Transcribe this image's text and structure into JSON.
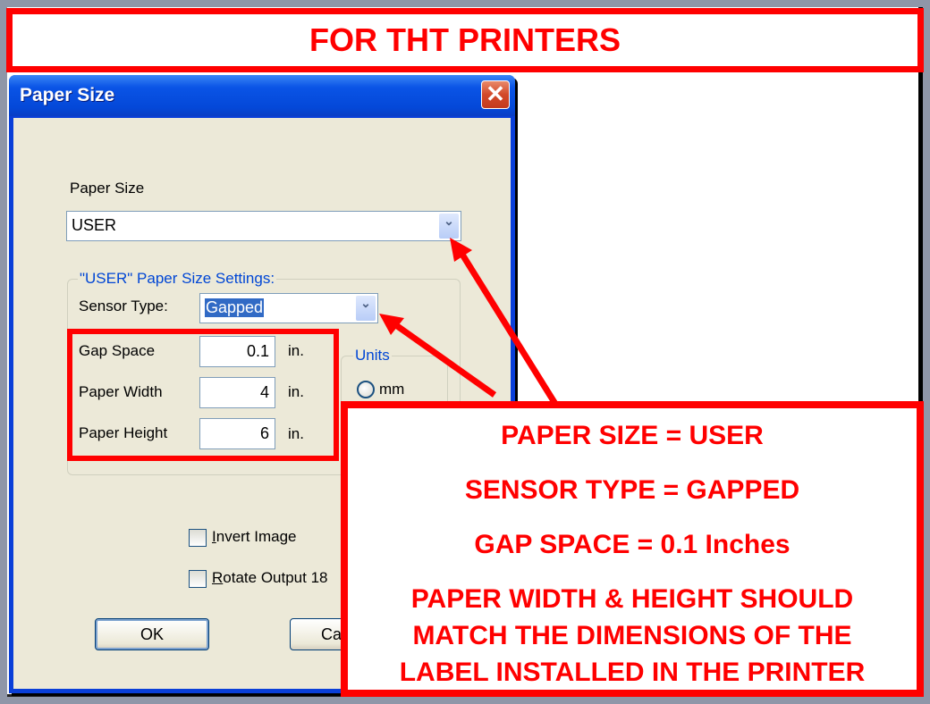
{
  "banner": {
    "text": "FOR THT PRINTERS"
  },
  "dialog": {
    "title": "Paper Size",
    "close_icon": "close-icon",
    "paper_size": {
      "label": "Paper Size",
      "value": "USER"
    },
    "user_group": {
      "title": "\"USER\" Paper Size Settings:",
      "sensor_type": {
        "label": "Sensor Type:",
        "value": "Gapped"
      },
      "gap_space": {
        "label": "Gap Space",
        "value": "0.1",
        "unit": "in."
      },
      "paper_width": {
        "label": "Paper Width",
        "value": "4",
        "unit": "in."
      },
      "paper_height": {
        "label": "Paper Height",
        "value": "6",
        "unit": "in."
      }
    },
    "units": {
      "title": "Units",
      "options": [
        {
          "label": "mm",
          "selected": false
        }
      ]
    },
    "invert_image": {
      "label_accel": "I",
      "label_rest": "nvert Image",
      "checked": false
    },
    "rotate_output": {
      "label_accel": "R",
      "label_rest": "otate Output 18",
      "checked": false
    },
    "ok_label": "OK",
    "cancel_label": "Ca"
  },
  "callout": {
    "lines": [
      "PAPER SIZE = USER",
      "SENSOR TYPE = GAPPED",
      "GAP SPACE = 0.1 Inches",
      "PAPER WIDTH & HEIGHT SHOULD",
      "MATCH THE DIMENSIONS OF THE",
      "LABEL INSTALLED IN THE PRINTER"
    ]
  },
  "colors": {
    "annotation_red": "#ff0000",
    "xp_title_blue": "#0a54e6",
    "dialog_face": "#ece9d8"
  }
}
